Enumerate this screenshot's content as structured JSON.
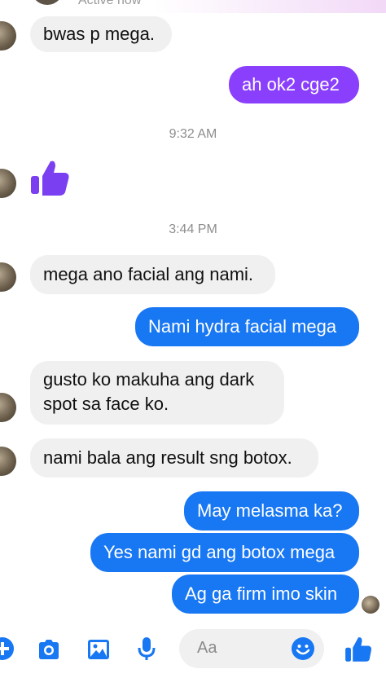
{
  "header": {
    "status": "Active now"
  },
  "messages": {
    "m1": "bwas p mega.",
    "m2": "ah ok2 cge2",
    "m3": "mega ano facial ang nami.",
    "m4": "Nami hydra facial mega",
    "m5": "gusto ko makuha ang dark spot sa face ko.",
    "m6": "nami bala ang result sng botox.",
    "m7": "May melasma ka?",
    "m8": "Yes nami gd ang botox mega",
    "m9": "Ag ga firm imo skin"
  },
  "timestamps": {
    "t1": "9:32 AM",
    "t2": "3:44 PM"
  },
  "composer": {
    "placeholder": "Aa"
  },
  "toolbar_icons": [
    "plus-icon",
    "camera-icon",
    "gallery-icon",
    "microphone-icon",
    "emoji-icon",
    "thumbs-up-icon"
  ],
  "colors": {
    "sent_purple": "#8a3ffc",
    "sent_blue": "#1877f2",
    "received_gray": "#f0f0f0",
    "like_purple": "#7b3ff2"
  }
}
